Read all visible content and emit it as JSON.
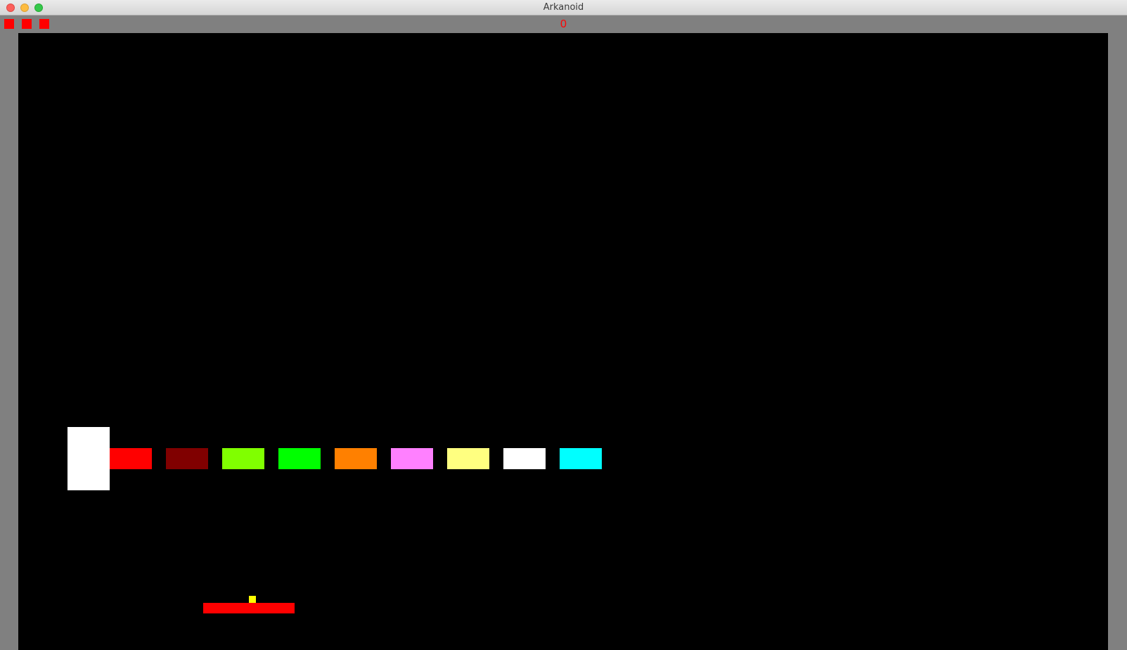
{
  "window": {
    "title": "Arkanoid"
  },
  "hud": {
    "score": "0",
    "lives": 3,
    "life_color": "#ff0000",
    "score_color": "#ff0000"
  },
  "colors": {
    "playfield": "#000000",
    "frame": "#808080",
    "paddle": "#ff0000",
    "ball": "#ffff00",
    "white_block": "#ffffff"
  },
  "bricks": [
    {
      "color": "#ff0000"
    },
    {
      "color": "#800000"
    },
    {
      "color": "#80ff00"
    },
    {
      "color": "#00ff00"
    },
    {
      "color": "#ff8000"
    },
    {
      "color": "#ff80ff"
    },
    {
      "color": "#ffff80"
    },
    {
      "color": "#ffffff"
    },
    {
      "color": "#00ffff"
    }
  ]
}
